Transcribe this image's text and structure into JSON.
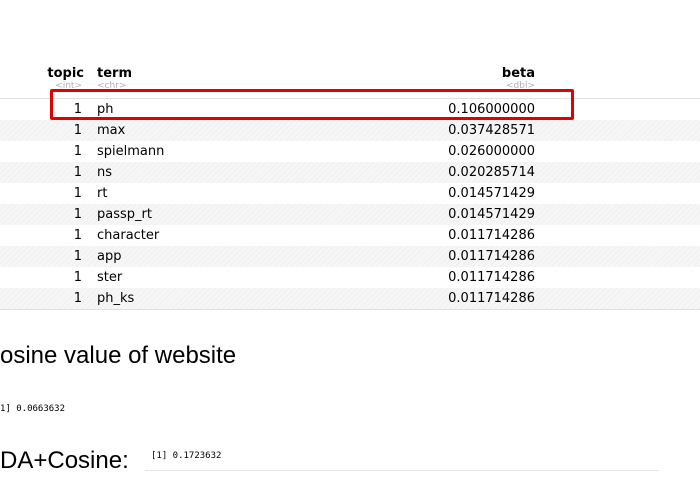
{
  "table": {
    "headers": {
      "topic": "topic",
      "topic_type": "<int>",
      "term": "term",
      "term_type": "<chr>",
      "beta": "beta",
      "beta_type": "<dbl>"
    },
    "rows": [
      {
        "topic": "1",
        "term": "ph",
        "beta": "0.106000000"
      },
      {
        "topic": "1",
        "term": "max",
        "beta": "0.037428571"
      },
      {
        "topic": "1",
        "term": "spielmann",
        "beta": "0.026000000"
      },
      {
        "topic": "1",
        "term": "ns",
        "beta": "0.020285714"
      },
      {
        "topic": "1",
        "term": "rt",
        "beta": "0.014571429"
      },
      {
        "topic": "1",
        "term": "passp_rt",
        "beta": "0.014571429"
      },
      {
        "topic": "1",
        "term": "character",
        "beta": "0.011714286"
      },
      {
        "topic": "1",
        "term": "app",
        "beta": "0.011714286"
      },
      {
        "topic": "1",
        "term": "ster",
        "beta": "0.011714286"
      },
      {
        "topic": "1",
        "term": "ph_ks",
        "beta": "0.011714286"
      }
    ]
  },
  "highlight_color": "#e00000",
  "section1": {
    "heading": "osine value of website",
    "output": "1] 0.0663632"
  },
  "section2": {
    "heading": "DA+Cosine:",
    "output": "[1] 0.1723632"
  }
}
